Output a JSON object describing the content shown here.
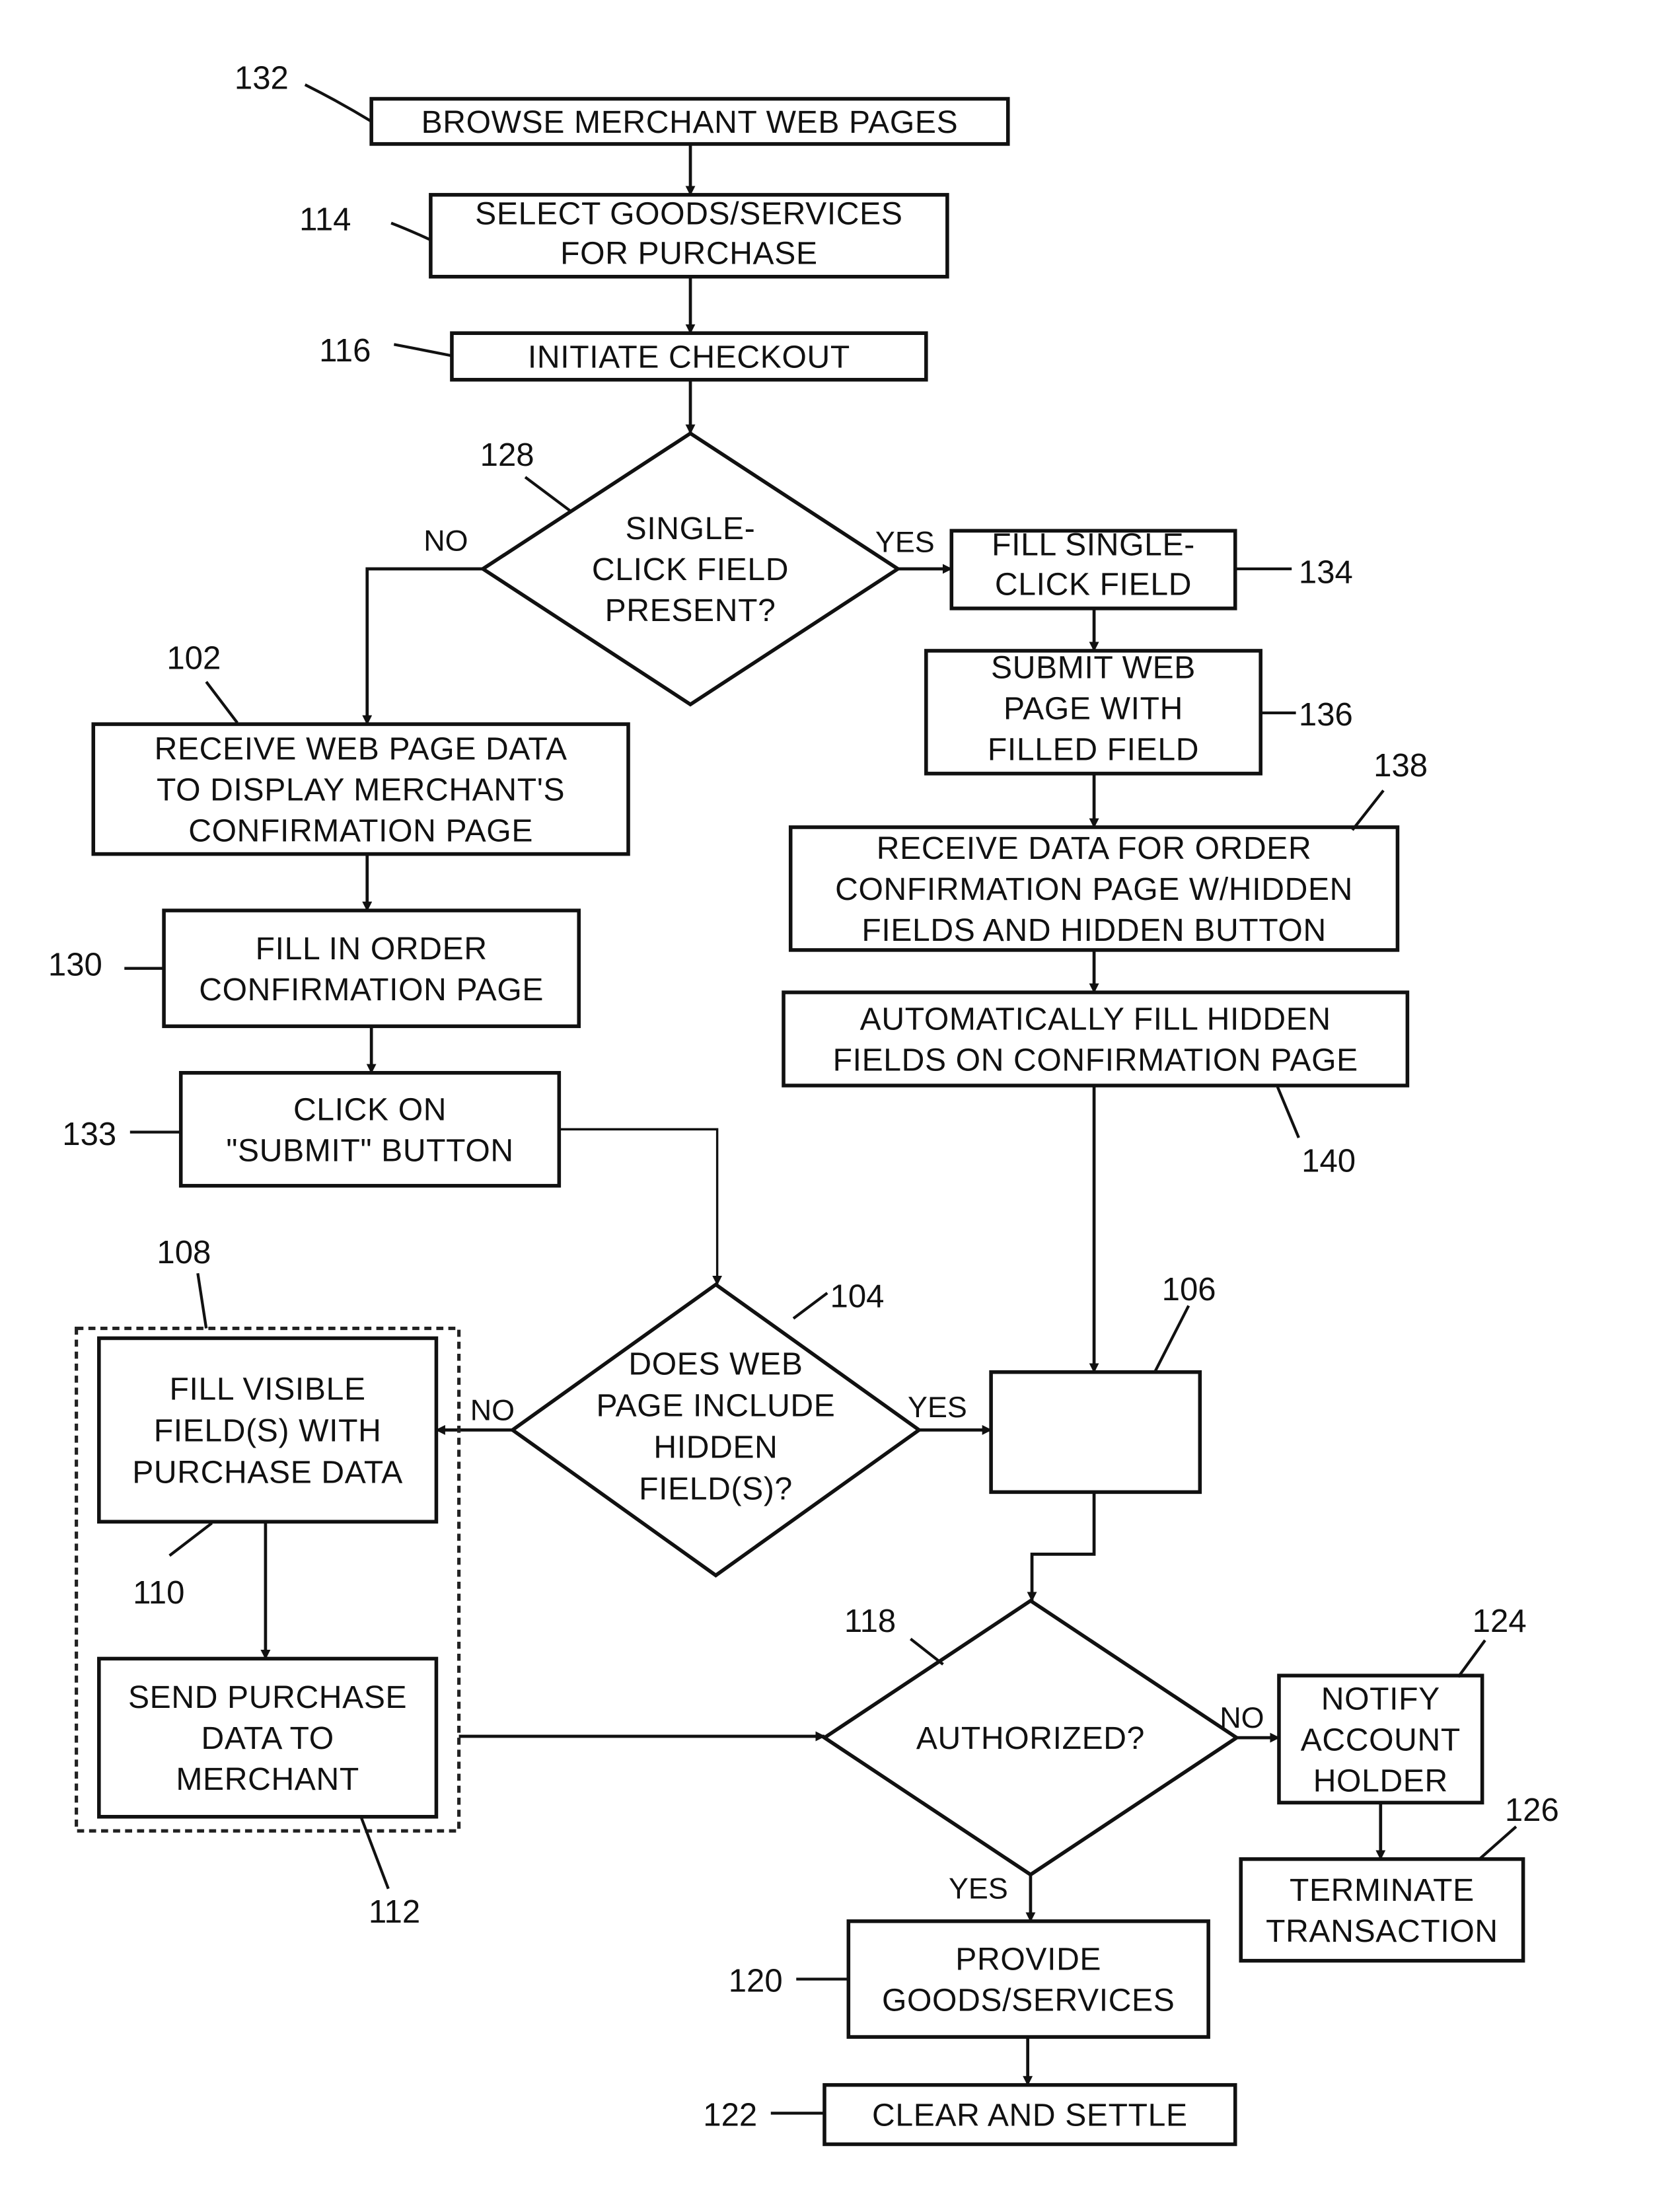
{
  "figure": {
    "type": "patent flowchart",
    "nodes": [
      {
        "id": "132",
        "kind": "process",
        "lines": [
          "BROWSE MERCHANT WEB PAGES"
        ]
      },
      {
        "id": "114",
        "kind": "process",
        "lines": [
          "SELECT GOODS/SERVICES",
          "FOR PURCHASE"
        ]
      },
      {
        "id": "116",
        "kind": "process",
        "lines": [
          "INITIATE CHECKOUT"
        ]
      },
      {
        "id": "128",
        "kind": "decision",
        "lines": [
          "SINGLE-",
          "CLICK FIELD",
          "PRESENT?"
        ]
      },
      {
        "id": "134",
        "kind": "process",
        "lines": [
          "FILL SINGLE-",
          "CLICK FIELD"
        ]
      },
      {
        "id": "136",
        "kind": "process",
        "lines": [
          "SUBMIT WEB",
          "PAGE WITH",
          "FILLED FIELD"
        ]
      },
      {
        "id": "138",
        "kind": "process",
        "lines": [
          "RECEIVE DATA FOR ORDER",
          "CONFIRMATION PAGE W/HIDDEN",
          "FIELDS AND HIDDEN BUTTON"
        ]
      },
      {
        "id": "140",
        "kind": "process",
        "lines": [
          "AUTOMATICALLY FILL HIDDEN",
          "FIELDS ON CONFIRMATION PAGE"
        ]
      },
      {
        "id": "102",
        "kind": "process",
        "lines": [
          "RECEIVE WEB PAGE DATA",
          "TO DISPLAY MERCHANT'S",
          "CONFIRMATION PAGE"
        ]
      },
      {
        "id": "130",
        "kind": "process",
        "lines": [
          "FILL IN ORDER",
          "CONFIRMATION PAGE"
        ]
      },
      {
        "id": "133",
        "kind": "process",
        "lines": [
          "CLICK ON",
          "\"SUBMIT\" BUTTON"
        ]
      },
      {
        "id": "104",
        "kind": "decision",
        "lines": [
          "DOES WEB",
          "PAGE INCLUDE",
          "HIDDEN",
          "FIELD(S)?"
        ]
      },
      {
        "id": "106",
        "kind": "process",
        "lines": []
      },
      {
        "id": "108",
        "kind": "group",
        "lines": []
      },
      {
        "id": "110",
        "kind": "process",
        "lines": [
          "FILL VISIBLE",
          "FIELD(S) WITH",
          "PURCHASE DATA"
        ]
      },
      {
        "id": "112",
        "kind": "process",
        "lines": [
          "SEND PURCHASE",
          "DATA TO",
          "MERCHANT"
        ]
      },
      {
        "id": "118",
        "kind": "decision",
        "lines": [
          "AUTHORIZED?"
        ]
      },
      {
        "id": "124",
        "kind": "process",
        "lines": [
          "NOTIFY",
          "ACCOUNT",
          "HOLDER"
        ]
      },
      {
        "id": "126",
        "kind": "process",
        "lines": [
          "TERMINATE",
          "TRANSACTION"
        ]
      },
      {
        "id": "120",
        "kind": "process",
        "lines": [
          "PROVIDE",
          "GOODS/SERVICES"
        ]
      },
      {
        "id": "122",
        "kind": "process",
        "lines": [
          "CLEAR AND SETTLE"
        ]
      }
    ],
    "edges": [
      {
        "from": "132",
        "to": "114",
        "label": ""
      },
      {
        "from": "114",
        "to": "116",
        "label": ""
      },
      {
        "from": "116",
        "to": "128",
        "label": ""
      },
      {
        "from": "128",
        "to": "102",
        "label": "NO"
      },
      {
        "from": "128",
        "to": "134",
        "label": "YES"
      },
      {
        "from": "134",
        "to": "136",
        "label": ""
      },
      {
        "from": "136",
        "to": "138",
        "label": ""
      },
      {
        "from": "138",
        "to": "140",
        "label": ""
      },
      {
        "from": "140",
        "to": "106",
        "label": ""
      },
      {
        "from": "102",
        "to": "130",
        "label": ""
      },
      {
        "from": "130",
        "to": "133",
        "label": ""
      },
      {
        "from": "133",
        "to": "104",
        "label": ""
      },
      {
        "from": "104",
        "to": "110",
        "label": "NO"
      },
      {
        "from": "104",
        "to": "106",
        "label": "YES"
      },
      {
        "from": "110",
        "to": "112",
        "label": ""
      },
      {
        "from": "112",
        "to": "118",
        "label": ""
      },
      {
        "from": "106",
        "to": "118",
        "label": ""
      },
      {
        "from": "118",
        "to": "124",
        "label": "NO"
      },
      {
        "from": "118",
        "to": "120",
        "label": "YES"
      },
      {
        "from": "124",
        "to": "126",
        "label": ""
      },
      {
        "from": "120",
        "to": "122",
        "label": ""
      }
    ]
  }
}
